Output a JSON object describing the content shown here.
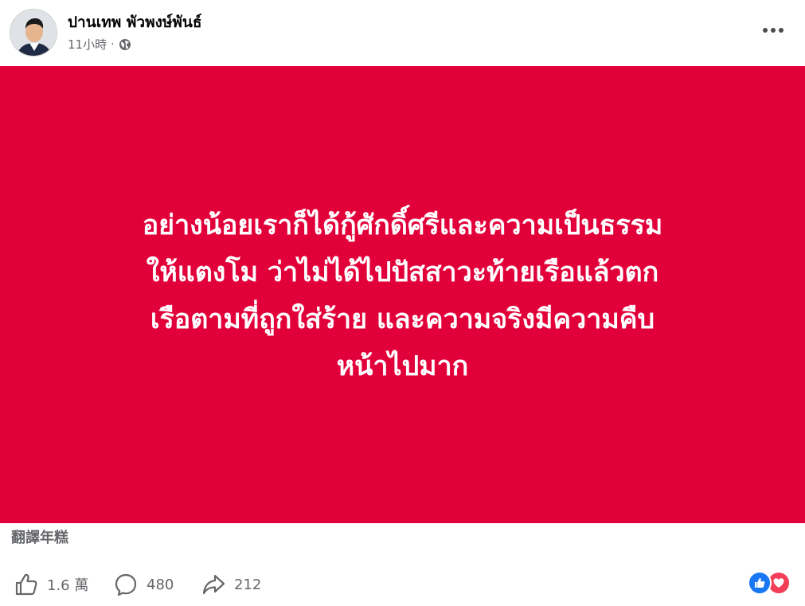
{
  "post": {
    "author": "ปานเทพ พัวพงษ์พันธ์",
    "time": "11小時",
    "separator": "·",
    "privacy_icon": "globe-icon",
    "more_icon": "more-options-icon"
  },
  "banner": {
    "background": "#e2003a",
    "text_color": "#ffffff",
    "lines": [
      "อย่างน้อยเราก็ได้กู้ศักดิ์ศรีและความเป็นธรรม",
      "ให้แตงโม ว่าไม่ได้ไปปัสสาวะท้ายเรือแล้วตก",
      "เรือตามที่ถูกใส่ร้าย และความจริงมีความคืบ",
      "หน้าไปมาก"
    ]
  },
  "translate_label": "翻譯年糕",
  "actions": {
    "like_count": "1.6 萬",
    "comment_count": "480",
    "share_count": "212"
  },
  "reactions": [
    "like",
    "love"
  ],
  "colors": {
    "secondary_text": "#65676b",
    "like_blue": "#1877f2",
    "love_red": "#f33e58"
  }
}
